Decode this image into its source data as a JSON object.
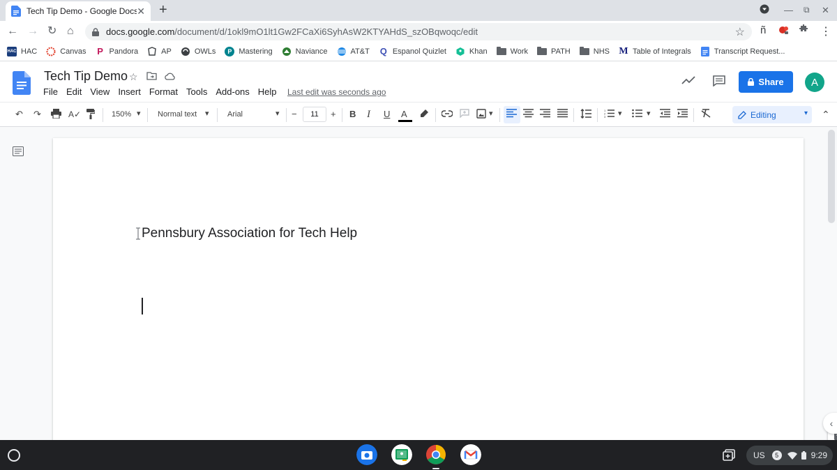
{
  "browser": {
    "tab_title": "Tech Tip Demo - Google Docs",
    "tab_close": "✕",
    "new_tab": "+",
    "url_host": "docs.google.com",
    "url_path": "/document/d/1okl9mO1lt1Gw2FCaXi6SyhAsW2KTYAHdS_szOBqwoqc/edit",
    "ext_letter": "ñ",
    "bookmarks": [
      {
        "label": "HAC",
        "icon": "hac-icon"
      },
      {
        "label": "Canvas",
        "icon": "canvas-icon"
      },
      {
        "label": "Pandora",
        "icon": "pandora-icon"
      },
      {
        "label": "AP",
        "icon": "ap-icon"
      },
      {
        "label": "OWLs",
        "icon": "owls-icon"
      },
      {
        "label": "Mastering",
        "icon": "mastering-icon"
      },
      {
        "label": "Naviance",
        "icon": "naviance-icon"
      },
      {
        "label": "AT&T",
        "icon": "att-icon"
      },
      {
        "label": "Espanol Quizlet",
        "icon": "quizlet-icon"
      },
      {
        "label": "Khan",
        "icon": "khan-icon"
      },
      {
        "label": "Work",
        "icon": "folder-icon"
      },
      {
        "label": "PATH",
        "icon": "folder-icon"
      },
      {
        "label": "NHS",
        "icon": "folder-icon"
      },
      {
        "label": "Table of Integrals",
        "icon": "integrals-icon"
      },
      {
        "label": "Transcript Request...",
        "icon": "docs-icon"
      }
    ]
  },
  "docs": {
    "title": "Tech Tip Demo",
    "menus": [
      "File",
      "Edit",
      "View",
      "Insert",
      "Format",
      "Tools",
      "Add-ons",
      "Help"
    ],
    "last_edit": "Last edit was seconds ago",
    "share_label": "Share",
    "avatar_letter": "A",
    "toolbar": {
      "zoom": "150%",
      "style": "Normal text",
      "font": "Arial",
      "font_size": "11",
      "mode": "Editing"
    },
    "body_text": "Pennsbury Association for Tech Help"
  },
  "shelf": {
    "region": "US",
    "notif_count": "5",
    "time": "9:29"
  },
  "colors": {
    "accent": "#1a73e8",
    "docs_blue": "#4285f4",
    "avatar": "#12a58a"
  }
}
